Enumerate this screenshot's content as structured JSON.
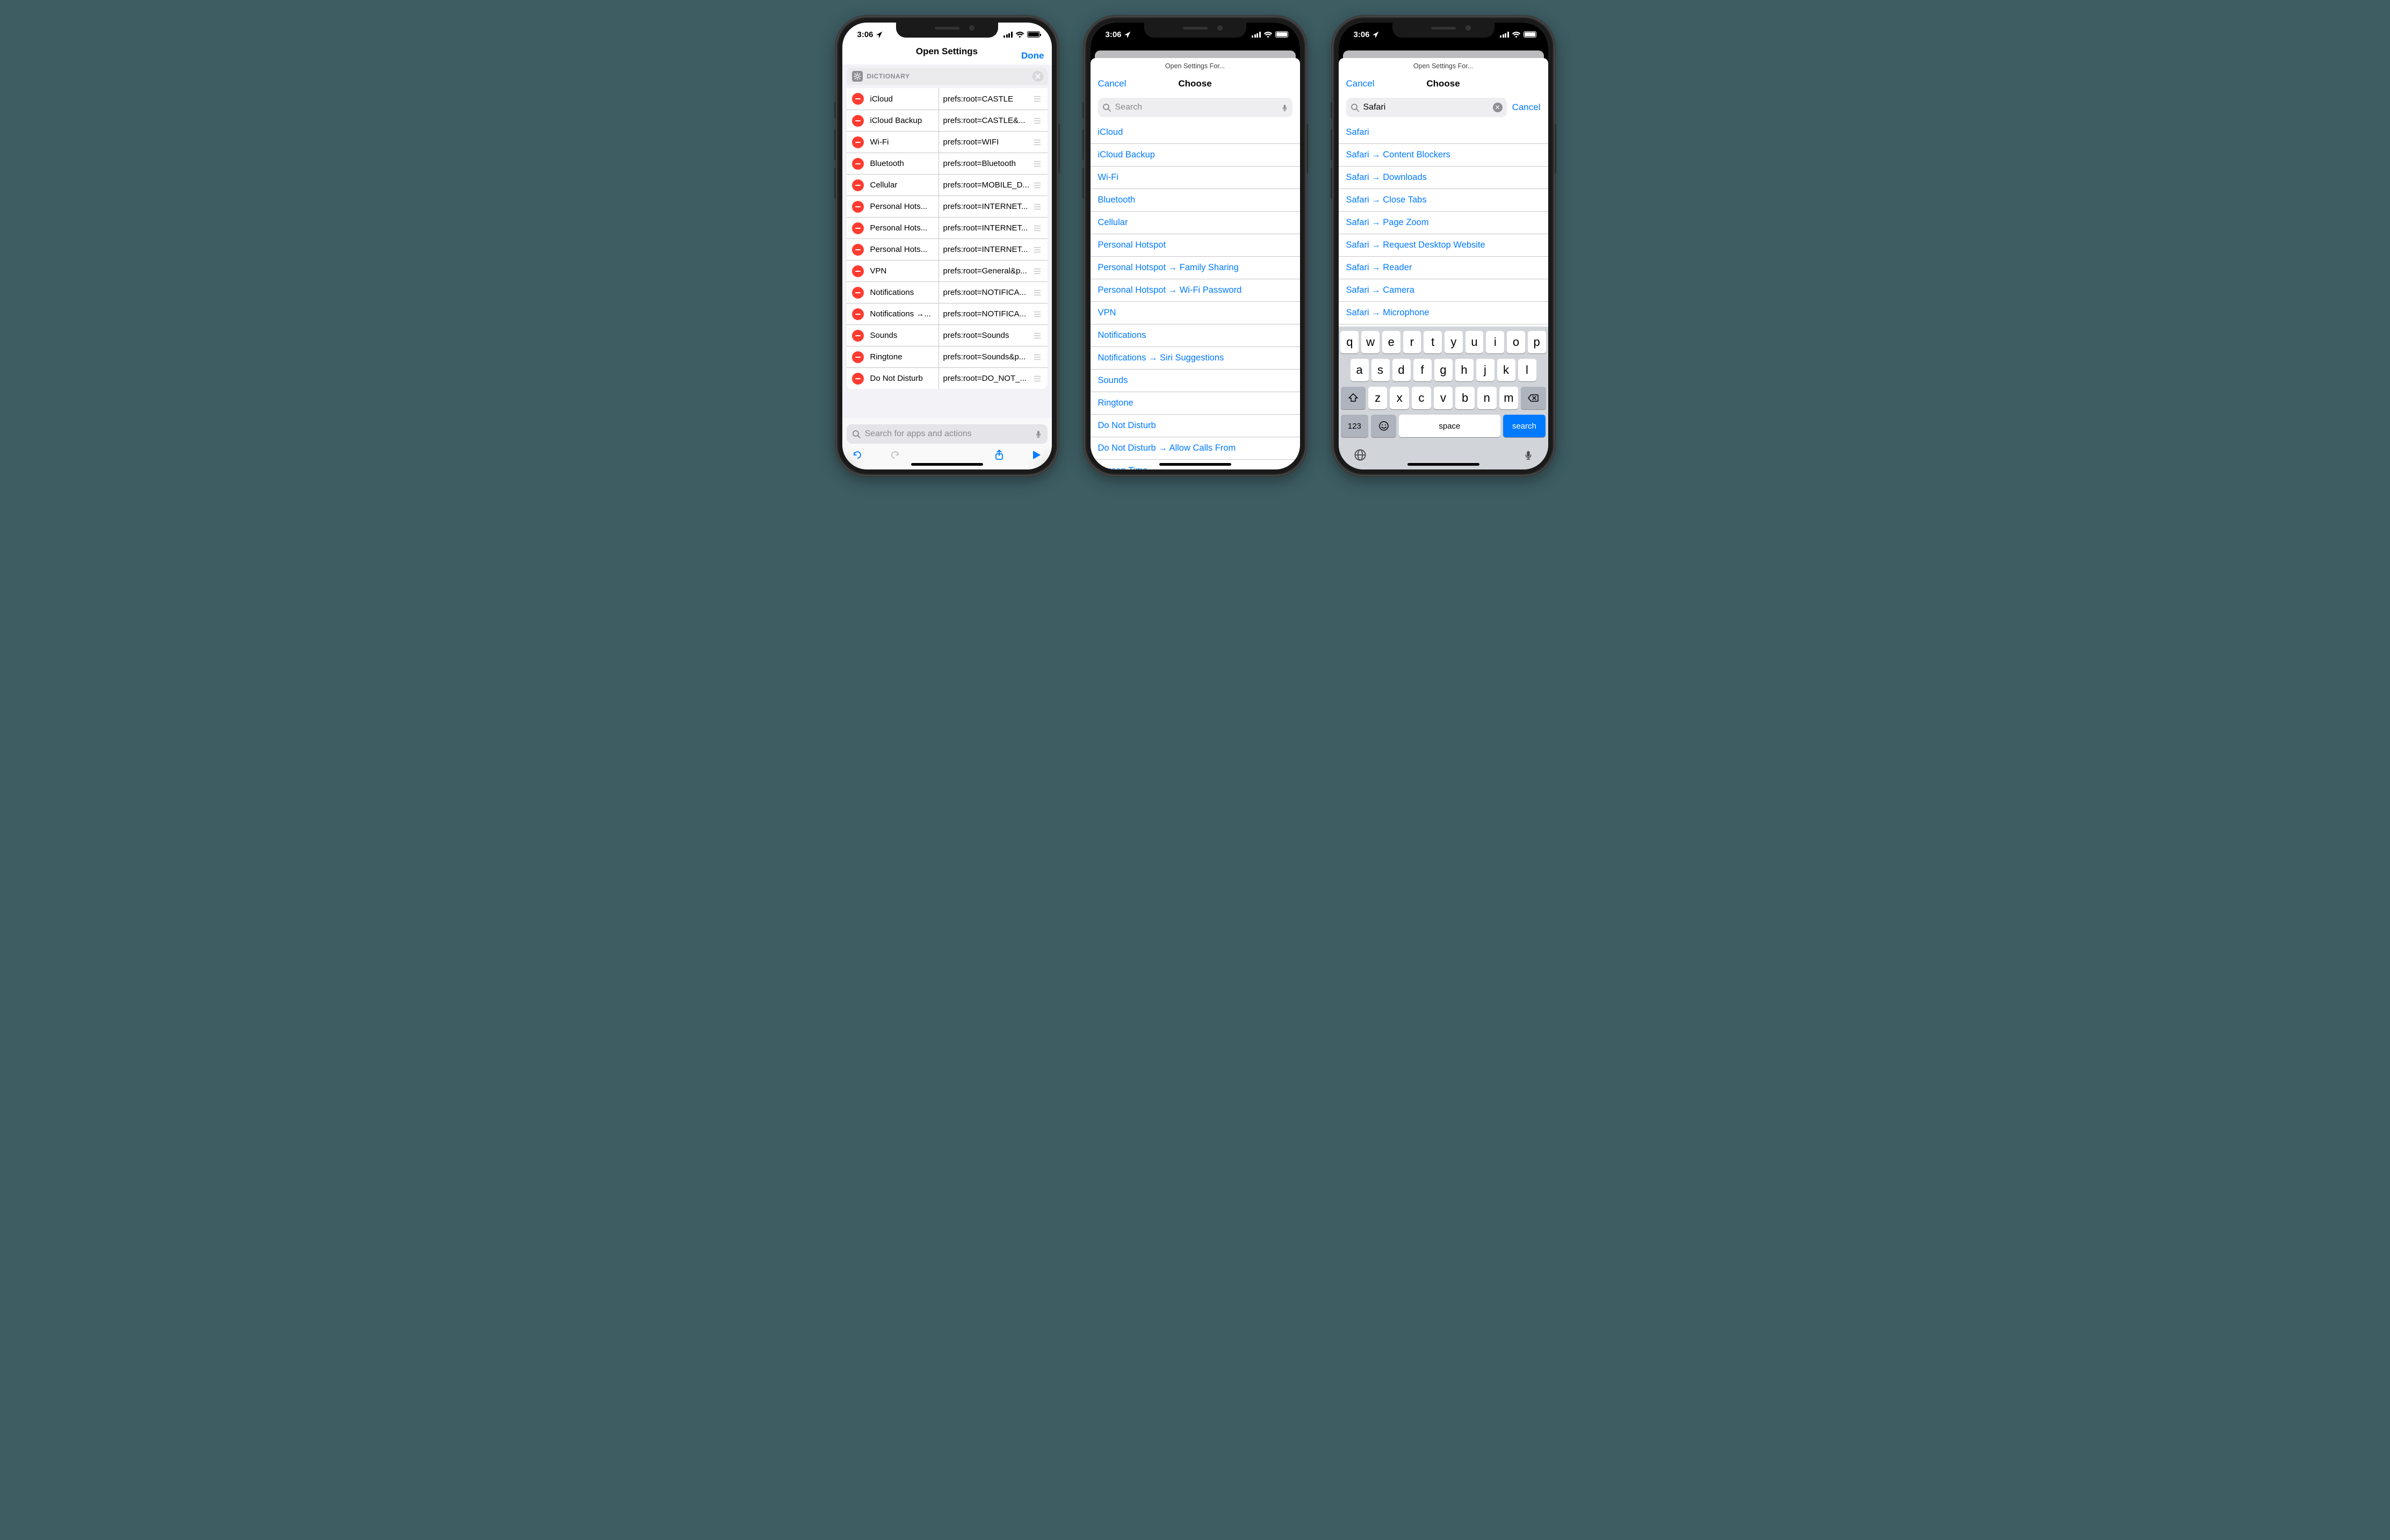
{
  "status": {
    "time": "3:06"
  },
  "phone1": {
    "nav": {
      "title": "Open Settings",
      "done": "Done"
    },
    "dict_label": "DICTIONARY",
    "rows": [
      {
        "k": "iCloud",
        "v": "prefs:root=CASTLE"
      },
      {
        "k": "iCloud Backup",
        "v": "prefs:root=CASTLE&..."
      },
      {
        "k": "Wi-Fi",
        "v": "prefs:root=WIFI"
      },
      {
        "k": "Bluetooth",
        "v": "prefs:root=Bluetooth"
      },
      {
        "k": "Cellular",
        "v": "prefs:root=MOBILE_D..."
      },
      {
        "k": "Personal Hots...",
        "v": "prefs:root=INTERNET..."
      },
      {
        "k": "Personal Hots...",
        "v": "prefs:root=INTERNET..."
      },
      {
        "k": "Personal Hots...",
        "v": "prefs:root=INTERNET..."
      },
      {
        "k": "VPN",
        "v": "prefs:root=General&p..."
      },
      {
        "k": "Notifications",
        "v": "prefs:root=NOTIFICA..."
      },
      {
        "k": "Notifications →...",
        "v": "prefs:root=NOTIFICA..."
      },
      {
        "k": "Sounds",
        "v": "prefs:root=Sounds"
      },
      {
        "k": "Ringtone",
        "v": "prefs:root=Sounds&p..."
      },
      {
        "k": "Do Not Disturb",
        "v": "prefs:root=DO_NOT_..."
      }
    ],
    "search_placeholder": "Search for apps and actions"
  },
  "phone2": {
    "back_title": "Open Settings For...",
    "nav": {
      "cancel": "Cancel",
      "title": "Choose"
    },
    "search_placeholder": "Search",
    "list": [
      "iCloud",
      "iCloud Backup",
      "Wi-Fi",
      "Bluetooth",
      "Cellular",
      "Personal Hotspot",
      "Personal Hotspot → Family Sharing",
      "Personal Hotspot → Wi-Fi Password",
      "VPN",
      "Notifications",
      "Notifications → Siri Suggestions",
      "Sounds",
      "Ringtone",
      "Do Not Disturb",
      "Do Not Disturb → Allow Calls From",
      "Screen Time"
    ]
  },
  "phone3": {
    "back_title": "Open Settings For...",
    "nav": {
      "cancel": "Cancel",
      "title": "Choose"
    },
    "search_value": "Safari",
    "search_cancel": "Cancel",
    "list": [
      "Safari",
      "Safari → Content Blockers",
      "Safari → Downloads",
      "Safari → Close Tabs",
      "Safari → Page Zoom",
      "Safari → Request Desktop Website",
      "Safari → Reader",
      "Safari → Camera",
      "Safari → Microphone"
    ],
    "kb": {
      "r1": [
        "q",
        "w",
        "e",
        "r",
        "t",
        "y",
        "u",
        "i",
        "o",
        "p"
      ],
      "r2": [
        "a",
        "s",
        "d",
        "f",
        "g",
        "h",
        "j",
        "k",
        "l"
      ],
      "r3": [
        "z",
        "x",
        "c",
        "v",
        "b",
        "n",
        "m"
      ],
      "numk": "123",
      "space": "space",
      "search": "search"
    }
  }
}
